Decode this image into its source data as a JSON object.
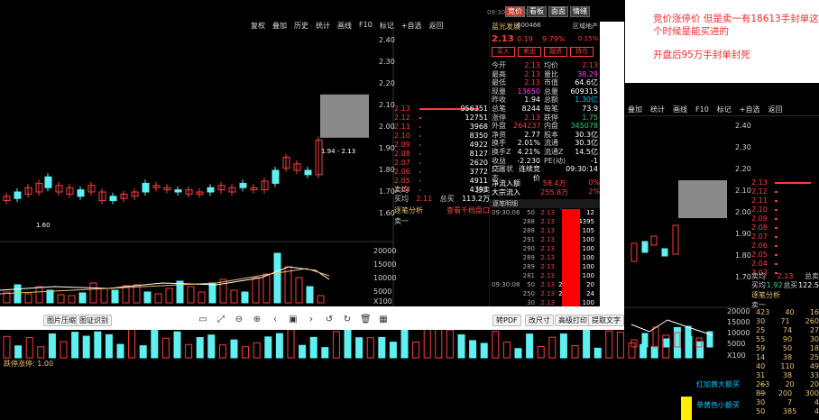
{
  "bg": {
    "toolbar": [
      "叠加",
      "统计",
      "画线",
      "F10",
      "标记",
      "+自选",
      "返回"
    ],
    "price_axis": [
      "2.40",
      "2.30",
      "2.20",
      "2.10",
      "2.00",
      "1.90",
      "1.80",
      "1.70"
    ],
    "orderbook_prices": [
      "2.13",
      "2.12",
      "2.11",
      "2.10",
      "2.09",
      "2.08",
      "2.07",
      "2.06",
      "2.05",
      "2.04",
      "2.03"
    ],
    "sell_info": {
      "k1": "卖均",
      "v1": "2.13",
      "k2": "总卖",
      "v2": "16",
      "k3": "买均",
      "v3": "1.92",
      "k4": "总买",
      "v4": "122.5"
    },
    "analysis": "逐笔分析",
    "buy1": "卖一",
    "ticks": [
      [
        "423",
        "40",
        "16"
      ],
      [
        "30",
        "71",
        "260"
      ],
      [
        "25",
        "74",
        "27"
      ],
      [
        "55",
        "90",
        "30"
      ],
      [
        "59",
        "50",
        "18"
      ],
      [
        "14",
        "38",
        "25"
      ],
      [
        "40",
        "110",
        "49"
      ],
      [
        "31",
        "38",
        "33"
      ],
      [
        "263",
        "20",
        "20"
      ],
      [
        "89",
        "200",
        "300"
      ],
      [
        "30",
        "7",
        "4"
      ],
      [
        "50",
        "385",
        "4"
      ]
    ],
    "dots": [
      "...",
      "..."
    ],
    "legend_red": "红加黄大额买",
    "legend_yellow": "单黄色小额买",
    "vol_axis": [
      "20000",
      "15000",
      "10000",
      "5000"
    ],
    "x100": "X100",
    "limit_label": "跌停涨停: 1.00"
  },
  "notes": {
    "line1": "竞价涨停价 但是卖一有18613手封单这个时候是能买进的",
    "line2": "开盘后95万手封单封死"
  },
  "fg": {
    "time": "09:30:14 周四",
    "topbar": [
      "竞价",
      "看板",
      "面面",
      "情绪"
    ],
    "toolbar": [
      "复权",
      "叠加",
      "历史",
      "统计",
      "画线",
      "F10",
      "标记",
      "+自选",
      "返回"
    ],
    "price_axis": [
      "2.40",
      "2.30",
      "2.20",
      "2.10",
      "2.00",
      "1.90",
      "1.80",
      "1.70",
      "1.60"
    ],
    "vol_axis": [
      "20000",
      "15000",
      "10000",
      "5000"
    ],
    "x100": "X100",
    "orderbook": [
      {
        "p": "2.13",
        "v": "956351",
        "w": 66
      },
      {
        "p": "2.12",
        "v": "12751",
        "w": 2
      },
      {
        "p": "2.11",
        "v": "3968",
        "w": 1
      },
      {
        "p": "2.10",
        "v": "8350",
        "w": 1
      },
      {
        "p": "2.09",
        "v": "4922",
        "w": 1
      },
      {
        "p": "2.08",
        "v": "8127",
        "w": 1
      },
      {
        "p": "2.07",
        "v": "2620",
        "w": 1
      },
      {
        "p": "2.06",
        "v": "3772",
        "w": 1
      },
      {
        "p": "2.05",
        "v": "4911",
        "w": 1
      },
      {
        "p": "2.04",
        "v": "4393",
        "w": 1
      }
    ],
    "sell_info": {
      "k1": "卖均",
      "v1": "",
      "k2": "总卖",
      "v2": "",
      "k3": "买均",
      "v3": "2.11",
      "k4": "总买",
      "v4": "113.2万"
    },
    "analysis_a": "逐笔分析",
    "analysis_b": "查看千档盘口",
    "sell1": "卖一",
    "stock": {
      "name": "蓝光发展",
      "code": "600466",
      "suffix": "R50",
      "sector": "区域地产",
      "price": "2.13",
      "change": "0.19",
      "pct": "9.79%",
      "sector_pct": "0.15%"
    },
    "actions": [
      "买入",
      "卖出",
      "融资",
      "持仓"
    ],
    "quote_rows": [
      [
        "今开",
        "2.13",
        "red",
        "均价",
        "2.13",
        "red"
      ],
      [
        "最高",
        "2.13",
        "red",
        "量比",
        "38.29",
        "magenta"
      ],
      [
        "最低",
        "2.13",
        "red",
        "市值",
        "64.6亿",
        "white"
      ],
      [
        "现量",
        "13650",
        "magenta",
        "总量",
        "609315",
        "white"
      ],
      [
        "昨收",
        "1.94",
        "white",
        "总额",
        "1.30亿",
        "cyan"
      ],
      [
        "总笔",
        "8244",
        "white",
        "每笔",
        "73.9",
        "white"
      ],
      [
        "涨停",
        "2.13",
        "red",
        "跌停",
        "1.75",
        "green"
      ],
      [
        "外盘",
        "264237",
        "red",
        "内盘",
        "345078",
        "green"
      ],
      [
        "净资",
        "2.77",
        "white",
        "股本",
        "30.3亿",
        "white"
      ],
      [
        "换手",
        "2.01%",
        "white",
        "流通",
        "30.3亿",
        "white"
      ],
      [
        "换手Z",
        "4.21%",
        "white",
        "流通Z",
        "14.5亿",
        "white"
      ],
      [
        "收益(三)",
        "-2.230",
        "white",
        "PE(动)",
        "-1",
        "white"
      ],
      [
        "交易状态",
        "连续竞价",
        "white",
        "",
        "09:30:14",
        "white"
      ]
    ],
    "flow": [
      {
        "k": "净流入额",
        "v": "58.4万",
        "p": "0%"
      },
      {
        "k": "大宗流入",
        "v": "255.8万",
        "p": "2%"
      }
    ],
    "ticks_head": "逐笔明细",
    "ticks": [
      [
        "09:30:06",
        "50",
        "2.13",
        "500",
        "12"
      ],
      [
        "",
        "288",
        "2.13",
        "500",
        "4395"
      ],
      [
        "",
        "288",
        "2.13",
        "500",
        "105"
      ],
      [
        "",
        "291",
        "2.13",
        "100",
        "100"
      ],
      [
        "",
        "290",
        "2.13",
        "100",
        "100"
      ],
      [
        "",
        "289",
        "2.13",
        "100",
        "100"
      ],
      [
        "",
        "289",
        "2.13",
        "100",
        "100"
      ],
      [
        "",
        "281",
        "2.13",
        "281",
        "100"
      ],
      [
        "09:30:08",
        "50",
        "2.13",
        "2500",
        "20"
      ],
      [
        "",
        "250",
        "2.13",
        "2500",
        "24"
      ],
      [
        "",
        "30",
        "2.13",
        "281",
        "100"
      ],
      [
        "",
        "20",
        "2.13",
        "200",
        "100"
      ],
      [
        "",
        "6",
        "2.13",
        "6",
        "100"
      ],
      [
        "",
        "3",
        "2.13",
        "3",
        "100"
      ]
    ]
  },
  "viewer": {
    "left_buttons": [
      "图片压缩",
      "图证识别"
    ],
    "right_buttons": [
      "转PDF",
      "改尺寸",
      "高级打印",
      "提取文字"
    ],
    "icons": [
      "monitor-icon",
      "fit-icon",
      "zoom-out-icon",
      "zoom-in-icon",
      "prev-icon",
      "slideshow-icon",
      "next-icon",
      "rotate-left-icon",
      "rotate-right-icon",
      "delete-icon",
      "gallery-icon"
    ]
  }
}
